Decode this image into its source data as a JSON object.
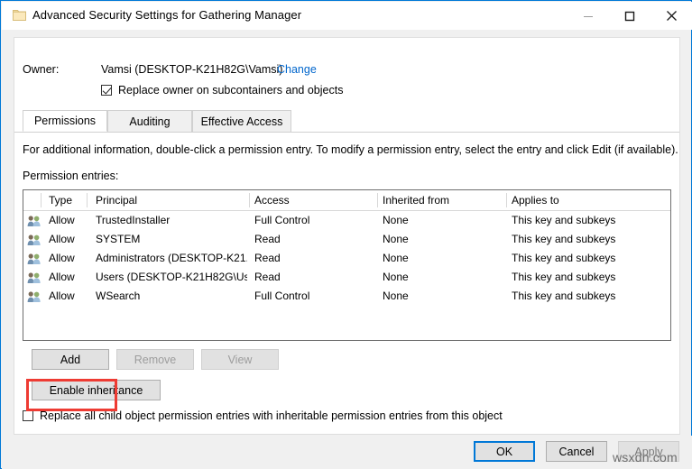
{
  "window": {
    "title": "Advanced Security Settings for Gathering Manager",
    "icon": "folder-icon",
    "controls": {
      "minimize": "—",
      "maximize": "☐",
      "close": "✕"
    },
    "accent_color": "#0078d7",
    "chrome_bg": "#f0f0f0"
  },
  "owner": {
    "label": "Owner:",
    "value": "Vamsi (DESKTOP-K21H82G\\Vamsi)",
    "change_link": "Change",
    "link_color": "#0066cc",
    "replace_owner_checkbox": {
      "label": "Replace owner on subcontainers and objects",
      "checked": true
    }
  },
  "tabs": [
    {
      "label": "Permissions",
      "active": true
    },
    {
      "label": "Auditing",
      "active": false
    },
    {
      "label": "Effective Access",
      "active": false
    }
  ],
  "main": {
    "info_text": "For additional information, double-click a permission entry. To modify a permission entry, select the entry and click Edit (if available).",
    "entries_label": "Permission entries:"
  },
  "table": {
    "columns": [
      "Type",
      "Principal",
      "Access",
      "Inherited from",
      "Applies to"
    ],
    "rows": [
      {
        "icon": "users-group-icon",
        "type": "Allow",
        "principal": "TrustedInstaller",
        "access": "Full Control",
        "inherited_from": "None",
        "applies_to": "This key and subkeys"
      },
      {
        "icon": "users-group-icon",
        "type": "Allow",
        "principal": "SYSTEM",
        "access": "Read",
        "inherited_from": "None",
        "applies_to": "This key and subkeys"
      },
      {
        "icon": "users-group-icon",
        "type": "Allow",
        "principal": "Administrators (DESKTOP-K21...",
        "access": "Read",
        "inherited_from": "None",
        "applies_to": "This key and subkeys"
      },
      {
        "icon": "users-group-icon",
        "type": "Allow",
        "principal": "Users (DESKTOP-K21H82G\\Us...",
        "access": "Read",
        "inherited_from": "None",
        "applies_to": "This key and subkeys"
      },
      {
        "icon": "users-group-icon",
        "type": "Allow",
        "principal": "WSearch",
        "access": "Full Control",
        "inherited_from": "None",
        "applies_to": "This key and subkeys"
      }
    ]
  },
  "entry_buttons": {
    "add": "Add",
    "remove": "Remove",
    "view": "View",
    "enable_inheritance": "Enable inheritance",
    "add_highlighted": true,
    "highlight_color": "#ee3b33",
    "remove_disabled": true,
    "view_disabled": true
  },
  "replace_all_checkbox": {
    "label": "Replace all child object permission entries with inheritable permission entries from this object",
    "checked": false
  },
  "footer": {
    "ok": "OK",
    "cancel": "Cancel",
    "apply": "Apply",
    "apply_disabled": true,
    "ok_focused": true
  },
  "watermark": "wsxdn.com"
}
